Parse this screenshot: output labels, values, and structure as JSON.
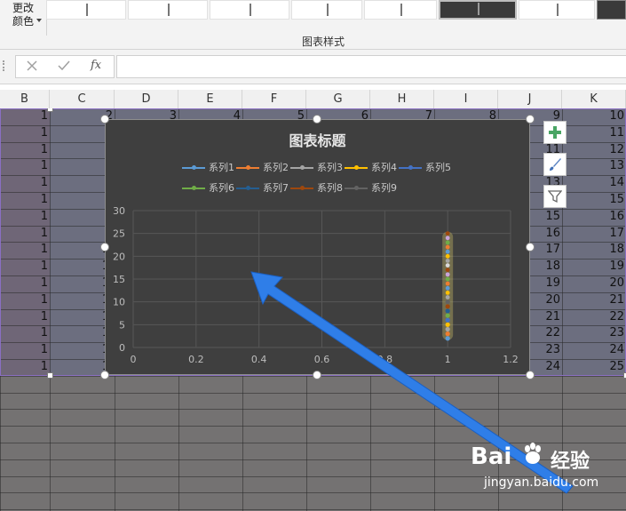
{
  "ribbon": {
    "change_color_line1": "更改",
    "change_color_line2": "颜色",
    "group_label": "图表样式"
  },
  "formula_bar": {
    "cancel_icon": "close-icon",
    "confirm_icon": "check-icon",
    "fx_label": "fx",
    "value": ""
  },
  "columns": [
    "B",
    "C",
    "D",
    "E",
    "F",
    "G",
    "H",
    "I",
    "J",
    "K"
  ],
  "sheet": {
    "b_values": [
      "1",
      "1",
      "1",
      "1",
      "1",
      "1",
      "1",
      "1",
      "1",
      "1",
      "1",
      "1",
      "1",
      "1",
      "1",
      "1"
    ],
    "c_top": "2",
    "c_partial": [
      "1",
      "1",
      "1",
      "1",
      "1",
      "1",
      "1",
      "1"
    ],
    "row_header_values": [
      "3",
      "4",
      "5",
      "6",
      "7",
      "8"
    ],
    "j_values": [
      "9",
      "10",
      "11",
      "12",
      "13",
      "14",
      "15",
      "16",
      "17",
      "18",
      "19",
      "20",
      "21",
      "22",
      "23",
      "24"
    ],
    "k_values": [
      "10",
      "11",
      "12",
      "13",
      "14",
      "15",
      "16",
      "17",
      "18",
      "19",
      "20",
      "21",
      "22",
      "23",
      "24",
      "25"
    ]
  },
  "chart": {
    "title": "图表标题",
    "side_buttons": [
      "plus-icon",
      "brush-icon",
      "filter-icon"
    ]
  },
  "chart_data": {
    "type": "scatter",
    "title": "图表标题",
    "xlim": [
      0,
      1.2
    ],
    "ylim": [
      0,
      30
    ],
    "x_ticks": [
      "0",
      "0.2",
      "0.4",
      "0.6",
      "0.8",
      "1",
      "1.2"
    ],
    "y_ticks": [
      "0",
      "5",
      "10",
      "15",
      "20",
      "25",
      "30"
    ],
    "grid": true,
    "legend_position": "top",
    "series": [
      {
        "name": "系列1",
        "color": "#5b9bd5",
        "x": [
          1
        ],
        "y": [
          2
        ]
      },
      {
        "name": "系列2",
        "color": "#ed7d31",
        "x": [
          1
        ],
        "y": [
          3
        ]
      },
      {
        "name": "系列3",
        "color": "#a5a5a5",
        "x": [
          1
        ],
        "y": [
          4
        ]
      },
      {
        "name": "系列4",
        "color": "#ffc000",
        "x": [
          1
        ],
        "y": [
          5
        ]
      },
      {
        "name": "系列5",
        "color": "#4472c4",
        "x": [
          1
        ],
        "y": [
          6
        ]
      },
      {
        "name": "系列6",
        "color": "#70ad47",
        "x": [
          1
        ],
        "y": [
          7
        ]
      },
      {
        "name": "系列7",
        "color": "#255e91",
        "x": [
          1
        ],
        "y": [
          8
        ]
      },
      {
        "name": "系列8",
        "color": "#9e480e",
        "x": [
          1
        ],
        "y": [
          9
        ]
      },
      {
        "name": "系列9",
        "color": "#636363",
        "x": [
          1
        ],
        "y": [
          10
        ]
      }
    ],
    "extra_points": {
      "x": 1,
      "y": [
        11,
        12,
        13,
        14,
        15,
        16,
        17,
        18,
        19,
        20,
        21,
        22,
        23,
        24,
        25
      ]
    }
  },
  "watermark": {
    "brand": "Bai",
    "brand2": "du",
    "site": "经验",
    "url": "jingyan.baidu.com"
  }
}
